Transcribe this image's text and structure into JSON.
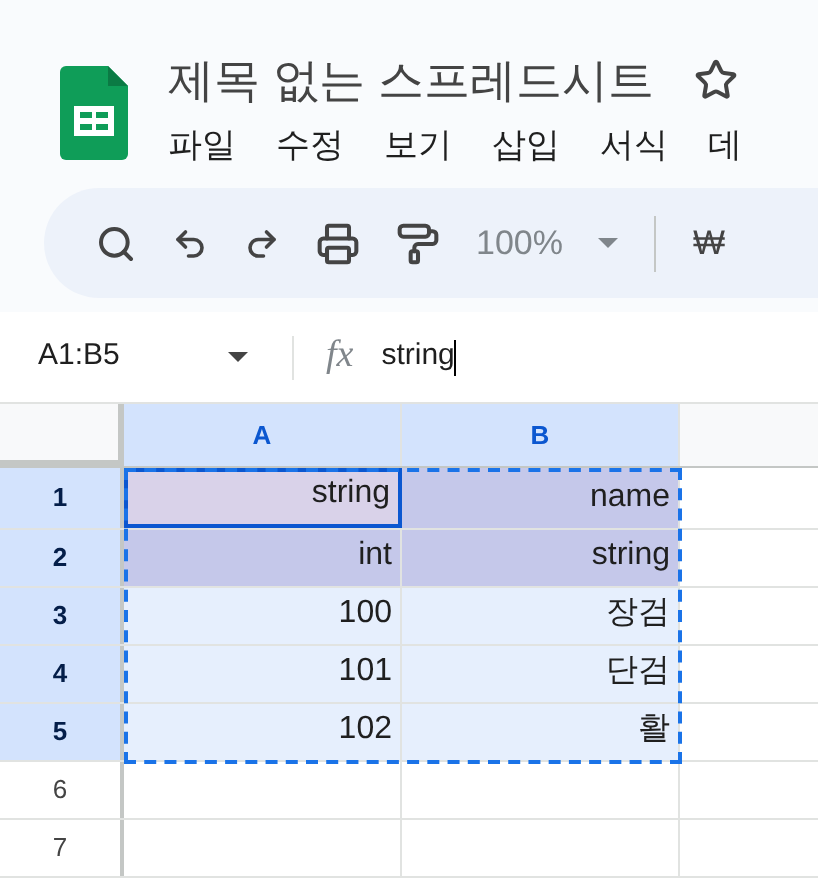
{
  "document": {
    "title": "제목 없는 스프레드시트",
    "starred": false
  },
  "menu": [
    "파일",
    "수정",
    "보기",
    "삽입",
    "서식",
    "데"
  ],
  "toolbar": {
    "zoom": "100%",
    "zoom_disabled": true,
    "currency": "₩"
  },
  "formula_bar": {
    "name_box": "A1:B5",
    "function_label": "fx",
    "formula": "string"
  },
  "sheet": {
    "columns": [
      {
        "label": "A",
        "selected": true
      },
      {
        "label": "B",
        "selected": true
      }
    ],
    "rows": [
      {
        "number": "1",
        "selected": true,
        "highlighted": true,
        "cells": [
          {
            "value": "string",
            "active": true
          },
          {
            "value": "name",
            "active": false
          }
        ]
      },
      {
        "number": "2",
        "selected": true,
        "highlighted": true,
        "cells": [
          {
            "value": "int",
            "active": false
          },
          {
            "value": "string",
            "active": false
          }
        ]
      },
      {
        "number": "3",
        "selected": true,
        "highlighted": false,
        "cells": [
          {
            "value": "100",
            "active": false
          },
          {
            "value": "장검",
            "active": false
          }
        ]
      },
      {
        "number": "4",
        "selected": true,
        "highlighted": false,
        "cells": [
          {
            "value": "101",
            "active": false
          },
          {
            "value": "단검",
            "active": false
          }
        ]
      },
      {
        "number": "5",
        "selected": true,
        "highlighted": false,
        "cells": [
          {
            "value": "102",
            "active": false
          },
          {
            "value": "활",
            "active": false
          }
        ]
      },
      {
        "number": "6",
        "selected": false,
        "highlighted": false,
        "cells": [
          {
            "active": false
          },
          {
            "active": false
          }
        ]
      },
      {
        "number": "7",
        "selected": false,
        "highlighted": false,
        "cells": [
          {
            "active": false
          },
          {
            "active": false
          }
        ]
      }
    ]
  }
}
